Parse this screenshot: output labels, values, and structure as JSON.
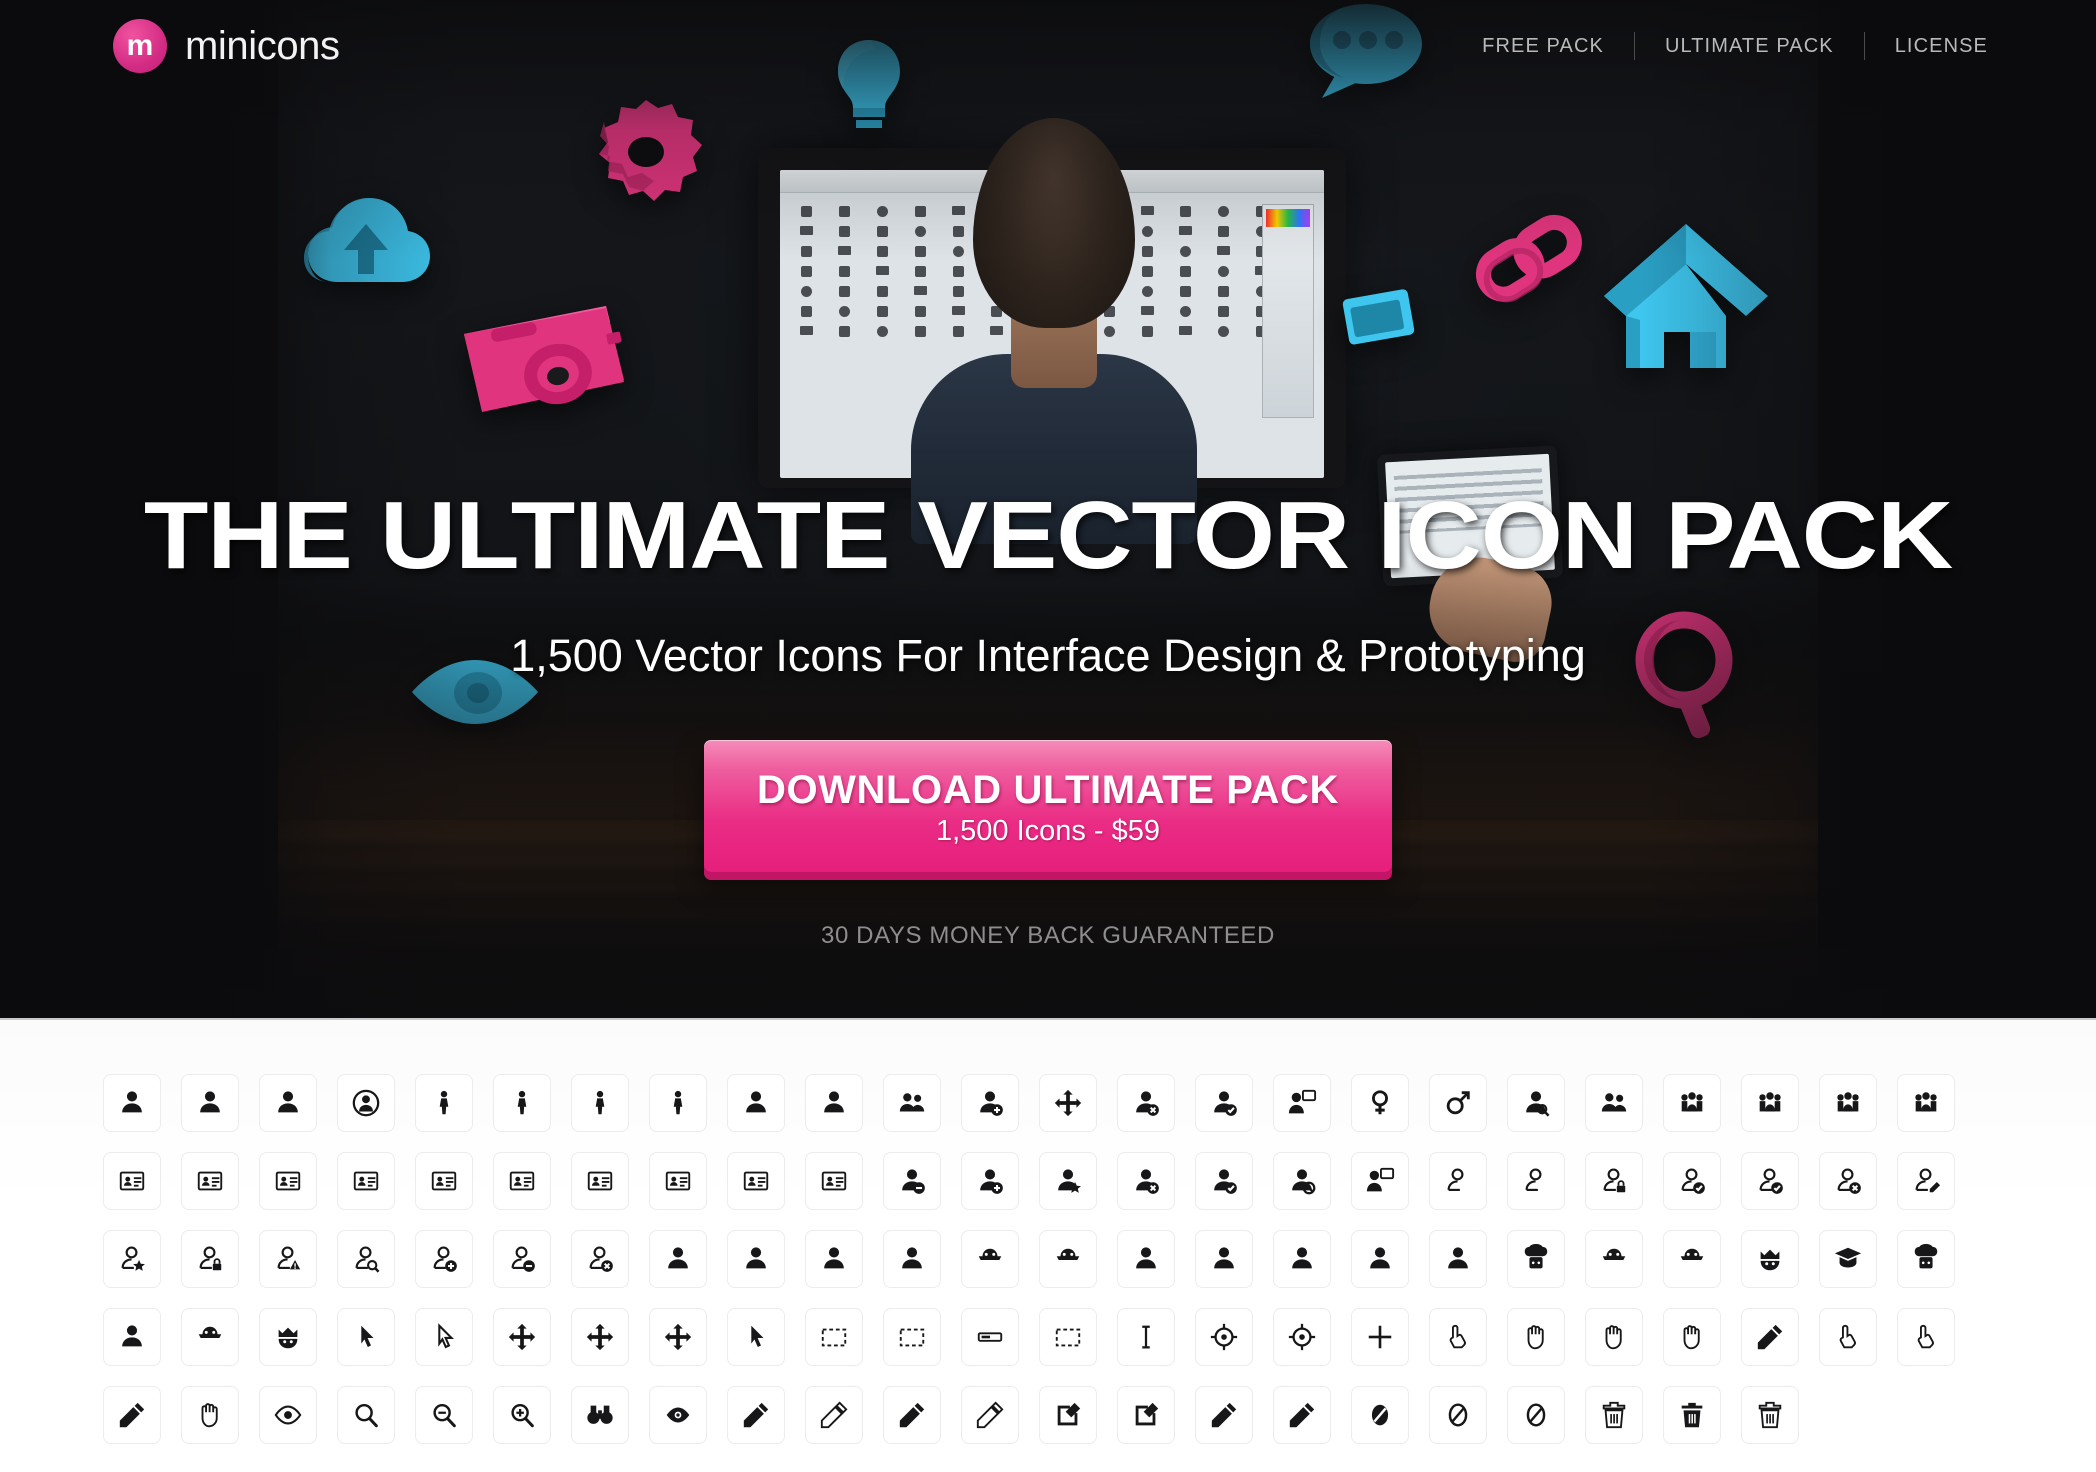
{
  "header": {
    "brand_mark": "m",
    "brand_name": "minicons",
    "nav": [
      {
        "label": "FREE PACK",
        "name": "nav-free-pack"
      },
      {
        "label": "ULTIMATE PACK",
        "name": "nav-ultimate-pack"
      },
      {
        "label": "LICENSE",
        "name": "nav-license"
      }
    ]
  },
  "hero": {
    "headline": "THE ULTIMATE VECTOR ICON PACK",
    "subheadline": "1,500 Vector Icons For Interface Design & Prototyping",
    "cta_main": "DOWNLOAD ULTIMATE PACK",
    "cta_sub": "1,500 Icons - $59",
    "guarantee": "30 DAYS MONEY BACK GUARANTEED",
    "floating_icons": [
      "lightbulb-icon",
      "chat-bubble-icon",
      "gear-icon",
      "cloud-upload-icon",
      "camera-icon",
      "link-icon",
      "home-icon",
      "picture-icon",
      "eye-icon",
      "magnifier-icon"
    ]
  },
  "colors": {
    "accent_pink": "#e61f7c",
    "accent_pink_light": "#ef5d9e",
    "accent_cyan": "#3ec6ef",
    "hero_background": "#0d0d0f",
    "nav_text": "#b9b9b9",
    "guarantee_text": "#8e8e8e",
    "icon_glyph": "#17171a",
    "tile_border": "#ececec"
  },
  "icon_grid": {
    "columns": 24,
    "rows": 6,
    "icons": [
      "user-silhouette-icon",
      "user-detective-icon",
      "user-female-icon",
      "user-circle-icon",
      "person-standing-icon",
      "person-tie-icon",
      "person-female-icon",
      "person-walk-icon",
      "user-head-icon",
      "user-tie-icon",
      "users-pair-icon",
      "user-add-icon",
      "user-remove-icon",
      "user-delete-icon",
      "user-check-icon",
      "user-comment-icon",
      "venus-icon",
      "mars-icon",
      "user-search-icon",
      "users-two-icon",
      "users-stack-icon",
      "people-group-icon",
      "people-crowd-icon",
      "people-team-icon",
      "org-chart-icon",
      "id-card-icon",
      "contact-card-icon",
      "vcard-icon",
      "address-book-icon",
      "business-card-icon",
      "contacts-list-icon",
      "badge-icon",
      "clipboard-user-icon",
      "picture-frame-user-icon",
      "user-minus-icon",
      "user-plus-icon",
      "user-star-icon",
      "user-cross-icon",
      "user-tick-icon",
      "user-block-icon",
      "user-speech-icon",
      "user-outline-icon",
      "user-outline-2-icon",
      "user-outline-block-icon",
      "user-outline-check-icon",
      "user-outline-tick-icon",
      "user-outline-x-icon",
      "user-outline-edit-icon",
      "user-outline-star-icon",
      "user-outline-lock-icon",
      "user-outline-warning-icon",
      "user-outline-search-icon",
      "user-outline-add-icon",
      "user-outline-minus-icon",
      "user-outline-delete-icon",
      "woman-icon",
      "child-icon",
      "girl-icon",
      "nurse-icon",
      "police-icon",
      "officer-icon",
      "worker-icon",
      "user-avatar-icon",
      "boy-icon",
      "baby-icon",
      "doctor-icon",
      "nurse-cap-icon",
      "ninja-icon",
      "spy-hat-icon",
      "king-crown-icon",
      "graduate-icon",
      "chef-icon",
      "astronaut-icon",
      "thief-icon",
      "king-icon",
      "cursor-arrow-icon",
      "cursor-outline-icon",
      "move-icon",
      "move-vertical-icon",
      "move-free-icon",
      "cursor-add-icon",
      "selection-icon",
      "align-icon",
      "input-bar-icon",
      "node-edit-icon",
      "text-cursor-icon",
      "target-icon",
      "crosshair-icon",
      "plus-thin-icon",
      "pointer-hand-icon",
      "hand-click-icon",
      "hand-sparkle-icon",
      "drag-icon",
      "hand-open-icon",
      "hand-point-icon",
      "hand-point-up-icon",
      "hand-open-fingers-icon",
      "hand-grab-icon",
      "eye-icon",
      "magnifier-icon",
      "zoom-out-icon",
      "zoom-in-icon",
      "binoculars-icon",
      "eye-bold-icon",
      "pencil-icon",
      "pencil-edit-icon",
      "pen-icon",
      "pen-diagonal-icon",
      "edit-square-icon",
      "edit-box-icon",
      "marker-icon",
      "pencil-sharp-icon",
      "eraser-icon",
      "eraser-outline-icon",
      "eraser-thin-icon",
      "trash-icon",
      "trash-full-icon",
      "trash-can-icon"
    ]
  }
}
